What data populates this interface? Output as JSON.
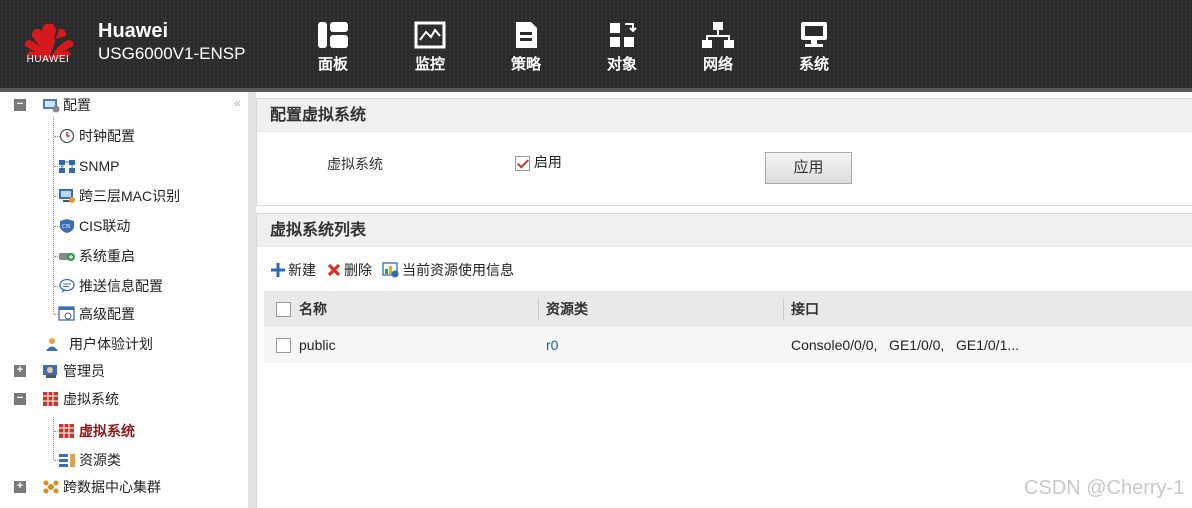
{
  "header": {
    "brand_name": "Huawei",
    "model": "USG6000V1-ENSP",
    "logo_text": "HUAWEI",
    "nav": [
      {
        "label": "面板",
        "icon": "dashboard-icon"
      },
      {
        "label": "监控",
        "icon": "monitor-icon"
      },
      {
        "label": "策略",
        "icon": "policy-icon"
      },
      {
        "label": "对象",
        "icon": "object-icon"
      },
      {
        "label": "网络",
        "icon": "network-icon"
      },
      {
        "label": "系统",
        "icon": "system-icon",
        "active": true
      }
    ]
  },
  "sidebar": {
    "collapse_glyph": "«",
    "items": [
      {
        "label": "配置",
        "expander": "−"
      },
      {
        "label": "时钟配置"
      },
      {
        "label": "SNMP"
      },
      {
        "label": "跨三层MAC识别"
      },
      {
        "label": "CIS联动"
      },
      {
        "label": "系统重启"
      },
      {
        "label": "推送信息配置"
      },
      {
        "label": "高级配置"
      },
      {
        "label": "用户体验计划"
      },
      {
        "label": "管理员",
        "expander": "+"
      },
      {
        "label": "虚拟系统",
        "expander": "−"
      },
      {
        "label": "虚拟系统",
        "active": true
      },
      {
        "label": "资源类"
      },
      {
        "label": "跨数据中心集群",
        "expander": "+"
      }
    ]
  },
  "config_panel": {
    "title": "配置虚拟系统",
    "field_label": "虚拟系统",
    "enable_label": "启用",
    "enable_checked": true,
    "apply_label": "应用"
  },
  "list_panel": {
    "title": "虚拟系统列表",
    "toolbar": {
      "new_label": "新建",
      "delete_label": "删除",
      "resource_info_label": "当前资源使用信息"
    },
    "columns": [
      "名称",
      "资源类",
      "接口"
    ],
    "rows": [
      {
        "name": "public",
        "resource_class": "r0",
        "interfaces": "Console0/0/0,   GE1/0/0,   GE1/0/1..."
      }
    ]
  },
  "watermark": "CSDN @Cherry-1",
  "colors": {
    "header_bg": "#2b2b2b",
    "active_red": "#8b1b1b",
    "link_blue": "#1b5fb3",
    "logo_red": "#d7191c"
  }
}
